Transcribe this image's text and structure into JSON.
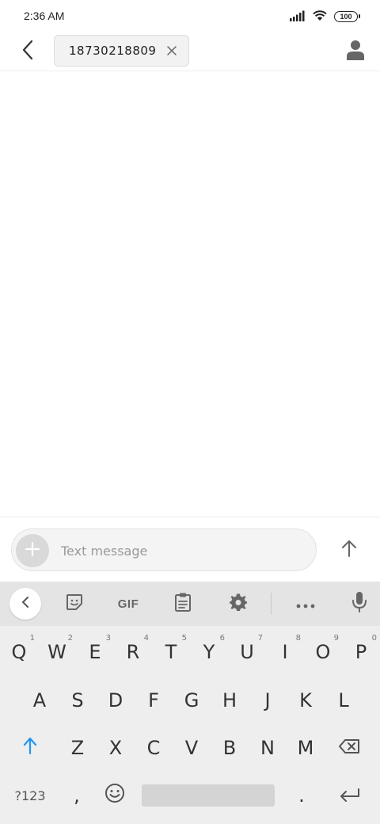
{
  "status_bar": {
    "time": "2:36 AM",
    "battery_level": "100",
    "icons": [
      "signal-icon",
      "wifi-icon",
      "battery-icon"
    ]
  },
  "header": {
    "back_icon": "chevron-left-icon",
    "recipient_number": "18730218809",
    "remove_icon": "close-icon",
    "contact_icon": "person-icon"
  },
  "compose": {
    "attach_icon": "plus-icon",
    "placeholder": "Text message",
    "value": "",
    "send_icon": "arrow-up-icon"
  },
  "keyboard": {
    "toolbar": {
      "collapse_icon": "chevron-left-icon",
      "sticker_icon": "sticker-icon",
      "gif_label": "GIF",
      "clipboard_icon": "clipboard-icon",
      "settings_icon": "gear-icon",
      "more_icon": "more-horizontal-icon",
      "mic_icon": "microphone-icon"
    },
    "row1": [
      {
        "key": "Q",
        "hint": "1"
      },
      {
        "key": "W",
        "hint": "2"
      },
      {
        "key": "E",
        "hint": "3"
      },
      {
        "key": "R",
        "hint": "4"
      },
      {
        "key": "T",
        "hint": "5"
      },
      {
        "key": "Y",
        "hint": "6"
      },
      {
        "key": "U",
        "hint": "7"
      },
      {
        "key": "I",
        "hint": "8"
      },
      {
        "key": "O",
        "hint": "9"
      },
      {
        "key": "P",
        "hint": "0"
      }
    ],
    "row2": [
      "A",
      "S",
      "D",
      "F",
      "G",
      "H",
      "J",
      "K",
      "L"
    ],
    "row3": [
      "Z",
      "X",
      "C",
      "V",
      "B",
      "N",
      "M"
    ],
    "row4": {
      "symbols_label": "?123",
      "comma": ",",
      "emoji_icon": "emoji-icon",
      "period": ".",
      "enter_icon": "enter-icon"
    },
    "shift_icon": "shift-arrow-icon",
    "backspace_icon": "backspace-icon",
    "accent_color": "#2196f3"
  },
  "colors": {
    "background": "#ffffff",
    "keyboard_bg": "#eeeeee",
    "toolbar_bg": "#e4e4e4",
    "icon_gray": "#666666"
  }
}
